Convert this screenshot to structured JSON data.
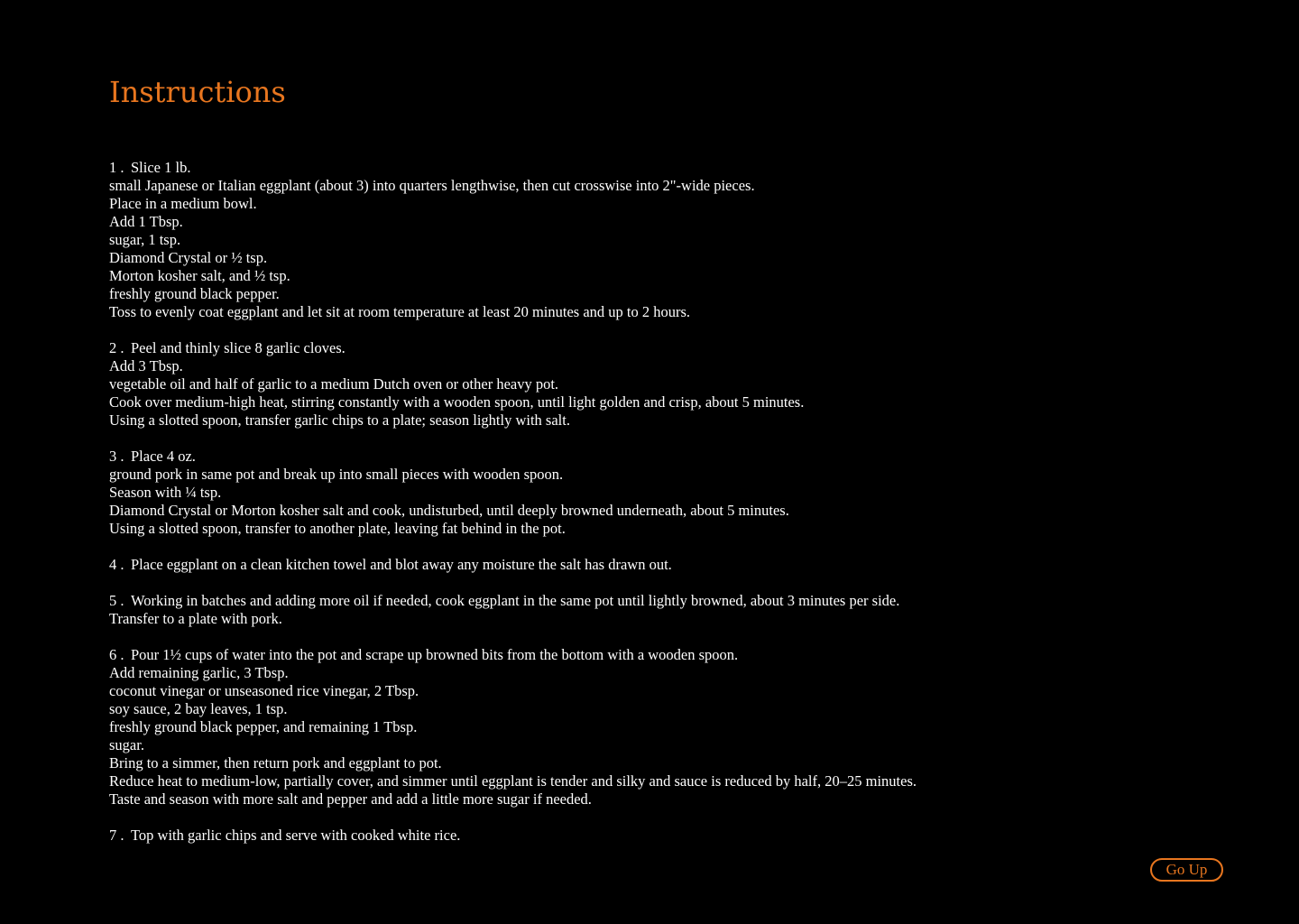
{
  "heading": "Instructions",
  "steps": [
    {
      "number": "1 .",
      "lines": [
        "Slice 1 lb.",
        "small Japanese or Italian eggplant (about 3) into quarters lengthwise, then cut crosswise into 2\"-wide pieces.",
        "Place in a medium bowl.",
        "Add 1 Tbsp.",
        "sugar, 1 tsp.",
        "Diamond Crystal or ½ tsp.",
        "Morton kosher salt, and ½ tsp.",
        "freshly ground black pepper.",
        "Toss to evenly coat eggplant and let sit at room temperature at least 20 minutes and up to 2 hours."
      ]
    },
    {
      "number": "2 .",
      "lines": [
        "Peel and thinly slice 8 garlic cloves.",
        "Add 3 Tbsp.",
        "vegetable oil and half of garlic to a medium Dutch oven or other heavy pot.",
        "Cook over medium-high heat, stirring constantly with a wooden spoon, until light golden and crisp, about 5 minutes.",
        "Using a slotted spoon, transfer garlic chips to a plate; season lightly with salt."
      ]
    },
    {
      "number": "3 .",
      "lines": [
        "Place 4 oz.",
        "ground pork in same pot and break up into small pieces with wooden spoon.",
        "Season with ¼ tsp.",
        "Diamond Crystal or Morton kosher salt and cook, undisturbed, until deeply browned underneath, about 5 minutes.",
        "Using a slotted spoon, transfer to another plate, leaving fat behind in the pot."
      ]
    },
    {
      "number": "4 .",
      "lines": [
        "Place eggplant on a clean kitchen towel and blot away any moisture the salt has drawn out."
      ]
    },
    {
      "number": "5 .",
      "lines": [
        "Working in batches and adding more oil if needed, cook eggplant in the same pot until lightly browned, about 3 minutes per side.",
        "Transfer to a plate with pork."
      ]
    },
    {
      "number": "6 .",
      "lines": [
        "Pour 1½ cups of water into the pot and scrape up browned bits from the bottom with a wooden spoon.",
        "Add remaining garlic, 3 Tbsp.",
        "coconut vinegar or unseasoned rice vinegar, 2 Tbsp.",
        "soy sauce, 2 bay leaves, 1 tsp.",
        "freshly ground black pepper, and remaining 1 Tbsp.",
        "sugar.",
        "Bring to a simmer, then return pork and eggplant to pot.",
        "Reduce heat to medium-low, partially cover, and simmer until eggplant is tender and silky and sauce is reduced by half, 20–25 minutes.",
        "Taste and season with more salt and pepper and add a little more sugar if needed."
      ]
    },
    {
      "number": "7 .",
      "lines": [
        "Top with garlic chips and serve with cooked white rice."
      ]
    }
  ],
  "go_up_label": "Go Up",
  "colors": {
    "background": "#000000",
    "accent": "#e8761f",
    "text": "#ffffff"
  }
}
